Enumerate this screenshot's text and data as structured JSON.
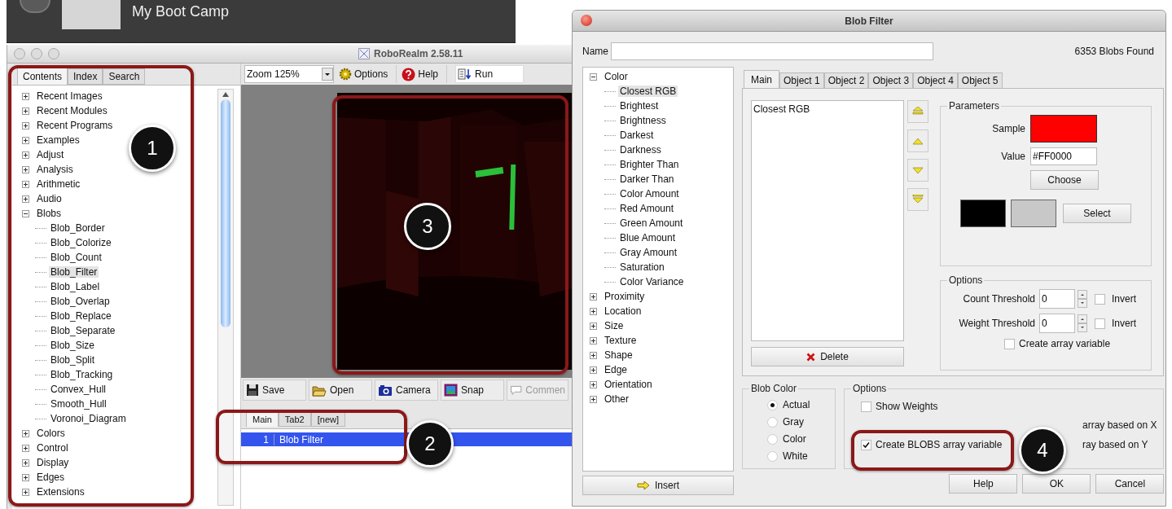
{
  "background_window": {
    "title": "My Boot Camp"
  },
  "main_window": {
    "title": "RoboRealm 2.58.11",
    "panel_tabs": [
      {
        "label": "Contents",
        "selected": true
      },
      {
        "label": "Index",
        "selected": false
      },
      {
        "label": "Search",
        "selected": false
      }
    ],
    "tree": [
      {
        "label": "Recent Images",
        "expanded": false
      },
      {
        "label": "Recent Modules",
        "expanded": false
      },
      {
        "label": "Recent Programs",
        "expanded": false
      },
      {
        "label": "Examples",
        "expanded": false
      },
      {
        "label": "Adjust",
        "expanded": false
      },
      {
        "label": "Analysis",
        "expanded": false
      },
      {
        "label": "Arithmetic",
        "expanded": false
      },
      {
        "label": "Audio",
        "expanded": false
      },
      {
        "label": "Blobs",
        "expanded": true,
        "children": [
          {
            "label": "Blob_Border",
            "selected": false
          },
          {
            "label": "Blob_Colorize",
            "selected": false
          },
          {
            "label": "Blob_Count",
            "selected": false
          },
          {
            "label": "Blob_Filter",
            "selected": true
          },
          {
            "label": "Blob_Label",
            "selected": false
          },
          {
            "label": "Blob_Overlap",
            "selected": false
          },
          {
            "label": "Blob_Replace",
            "selected": false
          },
          {
            "label": "Blob_Separate",
            "selected": false
          },
          {
            "label": "Blob_Size",
            "selected": false
          },
          {
            "label": "Blob_Split",
            "selected": false
          },
          {
            "label": "Blob_Tracking",
            "selected": false
          },
          {
            "label": "Convex_Hull",
            "selected": false
          },
          {
            "label": "Smooth_Hull",
            "selected": false
          },
          {
            "label": "Voronoi_Diagram",
            "selected": false
          }
        ]
      },
      {
        "label": "Colors",
        "expanded": false
      },
      {
        "label": "Control",
        "expanded": false
      },
      {
        "label": "Display",
        "expanded": false
      },
      {
        "label": "Edges",
        "expanded": false
      },
      {
        "label": "Extensions",
        "expanded": false
      }
    ],
    "zoom": "Zoom 125%",
    "toolbar": [
      {
        "kind": "options",
        "label": "Options"
      },
      {
        "kind": "help",
        "label": "Help"
      },
      {
        "kind": "run",
        "label": "Run"
      }
    ],
    "bottom_toolbar": [
      {
        "kind": "save",
        "label": "Save",
        "disabled": false
      },
      {
        "kind": "open",
        "label": "Open",
        "disabled": false
      },
      {
        "kind": "camera",
        "label": "Camera",
        "disabled": false
      },
      {
        "kind": "snap",
        "label": "Snap",
        "disabled": false
      },
      {
        "kind": "comment",
        "label": "Commen",
        "disabled": true
      }
    ],
    "pipeline_tabs": [
      {
        "label": "Main",
        "selected": true
      },
      {
        "label": "Tab2",
        "selected": false
      },
      {
        "label": "[new]",
        "selected": false
      }
    ],
    "pipeline": [
      {
        "number": "1",
        "name": "Blob Filter",
        "selected": true
      }
    ]
  },
  "dialog": {
    "title": "Blob Filter",
    "name_label": "Name",
    "status": "6353 Blobs Found",
    "tree": [
      {
        "label": "Color",
        "expanded": true,
        "children": [
          {
            "label": "Closest RGB",
            "selected": true
          },
          {
            "label": "Brightest",
            "selected": false
          },
          {
            "label": "Brightness",
            "selected": false
          },
          {
            "label": "Darkest",
            "selected": false
          },
          {
            "label": "Darkness",
            "selected": false
          },
          {
            "label": "Brighter Than",
            "selected": false
          },
          {
            "label": "Darker Than",
            "selected": false
          },
          {
            "label": "Color Amount",
            "selected": false
          },
          {
            "label": "Red Amount",
            "selected": false
          },
          {
            "label": "Green Amount",
            "selected": false
          },
          {
            "label": "Blue Amount",
            "selected": false
          },
          {
            "label": "Gray Amount",
            "selected": false
          },
          {
            "label": "Saturation",
            "selected": false
          },
          {
            "label": "Color Variance",
            "selected": false
          }
        ]
      },
      {
        "label": "Proximity",
        "expanded": false
      },
      {
        "label": "Location",
        "expanded": false
      },
      {
        "label": "Size",
        "expanded": false
      },
      {
        "label": "Texture",
        "expanded": false
      },
      {
        "label": "Shape",
        "expanded": false
      },
      {
        "label": "Edge",
        "expanded": false
      },
      {
        "label": "Orientation",
        "expanded": false
      },
      {
        "label": "Other",
        "expanded": false
      }
    ],
    "tabs": [
      {
        "label": "Main",
        "selected": true
      },
      {
        "label": "Object 1",
        "selected": false
      },
      {
        "label": "Object 2",
        "selected": false
      },
      {
        "label": "Object 3",
        "selected": false
      },
      {
        "label": "Object 4",
        "selected": false
      },
      {
        "label": "Object 5",
        "selected": false
      }
    ],
    "filters": [
      "Closest RGB"
    ],
    "delete": "Delete",
    "parameters": {
      "title": "Parameters",
      "sample": {
        "label": "Sample",
        "color": "#ff0000"
      },
      "value_label": "Value",
      "value": "#FF0000",
      "choose": "Choose",
      "swatches": [
        {
          "color": "#000000"
        },
        {
          "color": "#c8c8c8"
        }
      ],
      "select": "Select"
    },
    "thresholds": {
      "title": "Options",
      "rows": [
        {
          "label": "Count Threshold",
          "value": "0",
          "invert_label": "Invert",
          "invert": false
        },
        {
          "label": "Weight Threshold",
          "value": "0",
          "invert_label": "Invert",
          "invert": false
        }
      ],
      "array": {
        "label": "Create array variable",
        "checked": false
      }
    },
    "blob_color": {
      "title": "Blob Color",
      "options": [
        {
          "label": "Actual",
          "selected": true
        },
        {
          "label": "Gray",
          "selected": false
        },
        {
          "label": "Color",
          "selected": false
        },
        {
          "label": "White",
          "selected": false
        }
      ]
    },
    "options": {
      "title": "Options",
      "checkboxes": [
        {
          "label": "Show Weights",
          "checked": false
        },
        {
          "label": "Create BLOBS array variable",
          "checked": true
        }
      ],
      "cut_labels": [
        "array based on X",
        "ray based on Y"
      ]
    },
    "insert": "Insert",
    "buttons": [
      "Help",
      "OK",
      "Cancel"
    ]
  },
  "annotations": [
    "1",
    "2",
    "3",
    "4"
  ]
}
